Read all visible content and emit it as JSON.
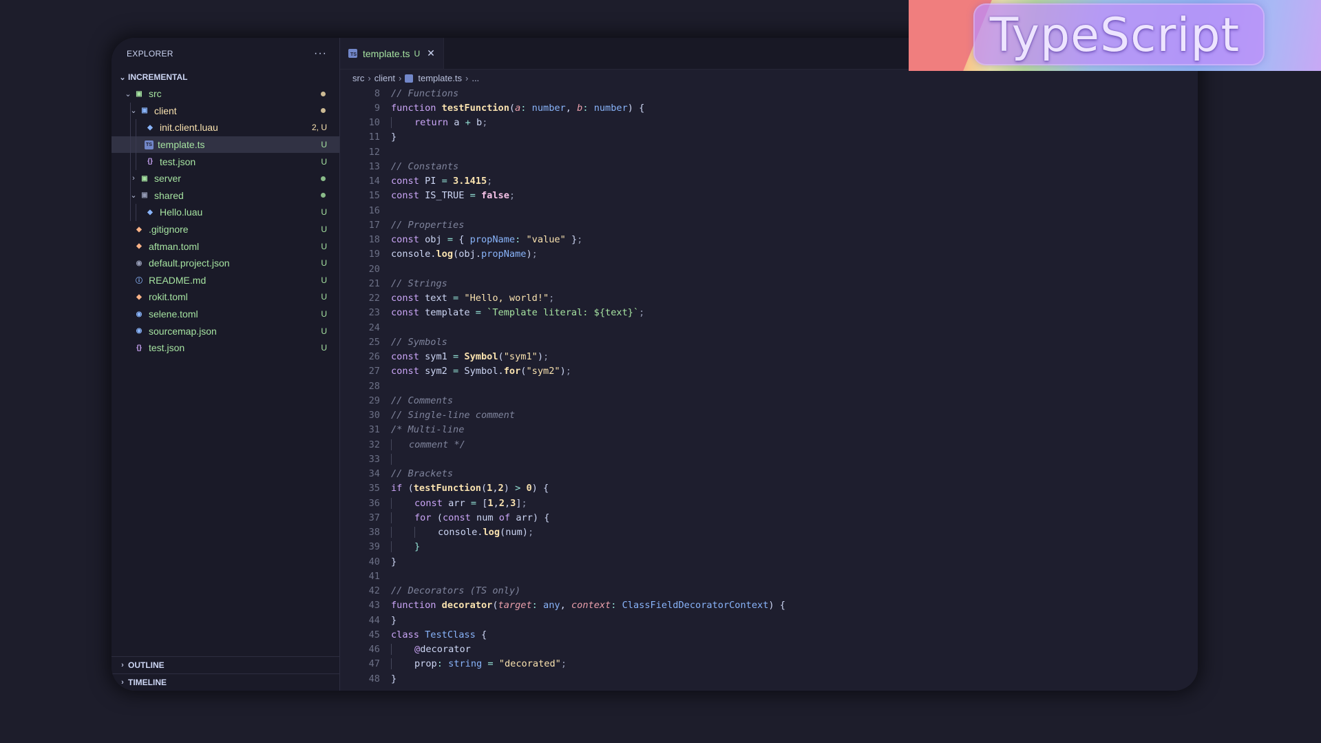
{
  "banner": {
    "text": "TypeScript"
  },
  "explorer": {
    "title": "EXPLORER",
    "more_label": "···",
    "project": "INCREMENTAL",
    "items": [
      {
        "label": "src",
        "depth": 0,
        "folder": true,
        "chev": "open",
        "color": "#a6e3a1",
        "icon": "src-folder-icon",
        "iconColor": "#a6e3a1",
        "dot": "#f9e2af"
      },
      {
        "label": "client",
        "depth": 1,
        "folder": true,
        "chev": "open",
        "color": "#f9e2af",
        "icon": "client-folder-icon",
        "iconColor": "#89b4fa",
        "dot": "#f9e2af"
      },
      {
        "label": "init.client.luau",
        "depth": 2,
        "folder": false,
        "color": "#f9e2af",
        "icon": "luau-file-icon",
        "iconColor": "#89b4fa",
        "badge": "2, U",
        "badgeColor": "#f9e2af"
      },
      {
        "label": "template.ts",
        "depth": 2,
        "folder": false,
        "color": "#a6e3a1",
        "icon": "typescript-file-icon",
        "iconColor": "#7287c9",
        "badge": "U",
        "badgeColor": "#a6e3a1",
        "selected": true
      },
      {
        "label": "test.json",
        "depth": 2,
        "folder": false,
        "color": "#a6e3a1",
        "icon": "json-file-icon",
        "iconColor": "#cba6f7",
        "badge": "U",
        "badgeColor": "#a6e3a1"
      },
      {
        "label": "server",
        "depth": 1,
        "folder": true,
        "chev": "closed",
        "color": "#a6e3a1",
        "icon": "server-folder-icon",
        "iconColor": "#a6e3a1",
        "dot": "#a6e3a1"
      },
      {
        "label": "shared",
        "depth": 1,
        "folder": true,
        "chev": "open",
        "color": "#a6e3a1",
        "icon": "shared-folder-icon",
        "iconColor": "#9399b2",
        "dot": "#a6e3a1"
      },
      {
        "label": "Hello.luau",
        "depth": 2,
        "folder": false,
        "color": "#a6e3a1",
        "icon": "luau-file-icon",
        "iconColor": "#89b4fa",
        "badge": "U",
        "badgeColor": "#a6e3a1"
      },
      {
        "label": ".gitignore",
        "depth": 0,
        "folder": false,
        "color": "#a6e3a1",
        "icon": "git-file-icon",
        "iconColor": "#fab387",
        "badge": "U",
        "badgeColor": "#a6e3a1"
      },
      {
        "label": "aftman.toml",
        "depth": 0,
        "folder": false,
        "color": "#a6e3a1",
        "icon": "toml-file-icon",
        "iconColor": "#fab387",
        "badge": "U",
        "badgeColor": "#a6e3a1"
      },
      {
        "label": "default.project.json",
        "depth": 0,
        "folder": false,
        "color": "#a6e3a1",
        "icon": "project-file-icon",
        "iconColor": "#9399b2",
        "badge": "U",
        "badgeColor": "#a6e3a1"
      },
      {
        "label": "README.md",
        "depth": 0,
        "folder": false,
        "color": "#a6e3a1",
        "icon": "info-file-icon",
        "iconColor": "#89b4fa",
        "badge": "U",
        "badgeColor": "#a6e3a1"
      },
      {
        "label": "rokit.toml",
        "depth": 0,
        "folder": false,
        "color": "#a6e3a1",
        "icon": "toml-file-icon",
        "iconColor": "#fab387",
        "badge": "U",
        "badgeColor": "#a6e3a1"
      },
      {
        "label": "selene.toml",
        "depth": 0,
        "folder": false,
        "color": "#a6e3a1",
        "icon": "selene-file-icon",
        "iconColor": "#89b4fa",
        "badge": "U",
        "badgeColor": "#a6e3a1"
      },
      {
        "label": "sourcemap.json",
        "depth": 0,
        "folder": false,
        "color": "#a6e3a1",
        "icon": "sourcemap-file-icon",
        "iconColor": "#89b4fa",
        "badge": "U",
        "badgeColor": "#a6e3a1"
      },
      {
        "label": "test.json",
        "depth": 0,
        "folder": false,
        "color": "#a6e3a1",
        "icon": "json-file-icon",
        "iconColor": "#cba6f7",
        "badge": "U",
        "badgeColor": "#a6e3a1"
      }
    ],
    "outline": "OUTLINE",
    "timeline": "TIMELINE"
  },
  "editor": {
    "tab": {
      "label": "template.ts",
      "status": "U",
      "close": "✕"
    },
    "breadcrumb": [
      "src",
      "client",
      "template.ts",
      "..."
    ],
    "lines": [
      {
        "n": 8,
        "i": 0,
        "t": [
          [
            "cm",
            "// Functions"
          ]
        ]
      },
      {
        "n": 9,
        "i": 0,
        "t": [
          [
            "kw",
            "function "
          ],
          [
            "fn",
            "testFunction"
          ],
          [
            "",
            "("
          ],
          [
            "pm",
            "a"
          ],
          [
            "op",
            ": "
          ],
          [
            "ty",
            "number"
          ],
          [
            "",
            ", "
          ],
          [
            "pm",
            "b"
          ],
          [
            "op",
            ": "
          ],
          [
            "ty",
            "number"
          ],
          [
            "",
            ") {"
          ]
        ]
      },
      {
        "n": 10,
        "i": 1,
        "t": [
          [
            "kw",
            "return "
          ],
          [
            "",
            "a "
          ],
          [
            "op",
            "+"
          ],
          [
            "",
            " b"
          ],
          [
            "pu",
            ";"
          ]
        ]
      },
      {
        "n": 11,
        "i": 0,
        "t": [
          [
            "",
            "}"
          ]
        ]
      },
      {
        "n": 12,
        "i": 0,
        "t": []
      },
      {
        "n": 13,
        "i": 0,
        "t": [
          [
            "cm",
            "// Constants"
          ]
        ]
      },
      {
        "n": 14,
        "i": 0,
        "t": [
          [
            "kw",
            "const "
          ],
          [
            "",
            "PI "
          ],
          [
            "op",
            "= "
          ],
          [
            "nm",
            "3.1415"
          ],
          [
            "pu",
            ";"
          ]
        ]
      },
      {
        "n": 15,
        "i": 0,
        "t": [
          [
            "kw",
            "const "
          ],
          [
            "",
            "IS_TRUE "
          ],
          [
            "op",
            "= "
          ],
          [
            "bl",
            "false"
          ],
          [
            "pu",
            ";"
          ]
        ]
      },
      {
        "n": 16,
        "i": 0,
        "t": []
      },
      {
        "n": 17,
        "i": 0,
        "t": [
          [
            "cm",
            "// Properties"
          ]
        ]
      },
      {
        "n": 18,
        "i": 0,
        "t": [
          [
            "kw",
            "const "
          ],
          [
            "",
            "obj "
          ],
          [
            "op",
            "= "
          ],
          [
            "",
            "{ "
          ],
          [
            "pr",
            "propName"
          ],
          [
            "op",
            ": "
          ],
          [
            "st",
            "\"value\""
          ],
          [
            "",
            " }"
          ],
          [
            "pu",
            ";"
          ]
        ]
      },
      {
        "n": 19,
        "i": 0,
        "t": [
          [
            "",
            "console."
          ],
          [
            "fn",
            "log"
          ],
          [
            "",
            "(obj."
          ],
          [
            "pr",
            "propName"
          ],
          [
            "",
            ")"
          ],
          [
            "pu",
            ";"
          ]
        ]
      },
      {
        "n": 20,
        "i": 0,
        "t": []
      },
      {
        "n": 21,
        "i": 0,
        "t": [
          [
            "cm",
            "// Strings"
          ]
        ]
      },
      {
        "n": 22,
        "i": 0,
        "t": [
          [
            "kw",
            "const "
          ],
          [
            "",
            "text "
          ],
          [
            "op",
            "= "
          ],
          [
            "st",
            "\"Hello, world!\""
          ],
          [
            "pu",
            ";"
          ]
        ]
      },
      {
        "n": 23,
        "i": 0,
        "t": [
          [
            "kw",
            "const "
          ],
          [
            "",
            "template "
          ],
          [
            "op",
            "= "
          ],
          [
            "sx",
            "`Template literal: ${text}`"
          ],
          [
            "pu",
            ";"
          ]
        ]
      },
      {
        "n": 24,
        "i": 0,
        "t": []
      },
      {
        "n": 25,
        "i": 0,
        "t": [
          [
            "cm",
            "// Symbols"
          ]
        ]
      },
      {
        "n": 26,
        "i": 0,
        "t": [
          [
            "kw",
            "const "
          ],
          [
            "",
            "sym1 "
          ],
          [
            "op",
            "= "
          ],
          [
            "fn",
            "Symbol"
          ],
          [
            "",
            "("
          ],
          [
            "st",
            "\"sym1\""
          ],
          [
            "",
            ")"
          ],
          [
            "pu",
            ";"
          ]
        ]
      },
      {
        "n": 27,
        "i": 0,
        "t": [
          [
            "kw",
            "const "
          ],
          [
            "",
            "sym2 "
          ],
          [
            "op",
            "= "
          ],
          [
            "",
            "Symbol."
          ],
          [
            "fn",
            "for"
          ],
          [
            "",
            "("
          ],
          [
            "st",
            "\"sym2\""
          ],
          [
            "",
            ")"
          ],
          [
            "pu",
            ";"
          ]
        ]
      },
      {
        "n": 28,
        "i": 0,
        "t": []
      },
      {
        "n": 29,
        "i": 0,
        "t": [
          [
            "cm",
            "// Comments"
          ]
        ]
      },
      {
        "n": 30,
        "i": 0,
        "t": [
          [
            "cm",
            "// Single-line comment"
          ]
        ]
      },
      {
        "n": 31,
        "i": 0,
        "t": [
          [
            "cm",
            "/* Multi-line"
          ]
        ]
      },
      {
        "n": 32,
        "i": 1,
        "t": [
          [
            "cm",
            "comment */"
          ]
        ],
        "pad": "   "
      },
      {
        "n": 33,
        "i": 1,
        "t": []
      },
      {
        "n": 34,
        "i": 0,
        "t": [
          [
            "cm",
            "// Brackets"
          ]
        ]
      },
      {
        "n": 35,
        "i": 0,
        "t": [
          [
            "kw",
            "if "
          ],
          [
            "",
            "("
          ],
          [
            "fn",
            "testFunction"
          ],
          [
            "",
            "("
          ],
          [
            "nm",
            "1"
          ],
          [
            "",
            ","
          ],
          [
            "nm",
            "2"
          ],
          [
            "",
            ") "
          ],
          [
            "op",
            "> "
          ],
          [
            "nm",
            "0"
          ],
          [
            "",
            ") {"
          ]
        ]
      },
      {
        "n": 36,
        "i": 1,
        "t": [
          [
            "kw",
            "const "
          ],
          [
            "",
            "arr "
          ],
          [
            "op",
            "= "
          ],
          [
            "",
            "["
          ],
          [
            "nm",
            "1"
          ],
          [
            "",
            ","
          ],
          [
            "nm",
            "2"
          ],
          [
            "",
            ","
          ],
          [
            "nm",
            "3"
          ],
          [
            "",
            "]"
          ],
          [
            "pu",
            ";"
          ]
        ]
      },
      {
        "n": 37,
        "i": 1,
        "t": [
          [
            "kw",
            "for "
          ],
          [
            "",
            "("
          ],
          [
            "kw",
            "const "
          ],
          [
            "",
            "num "
          ],
          [
            "kw",
            "of "
          ],
          [
            "",
            "arr) {"
          ]
        ]
      },
      {
        "n": 38,
        "i": 2,
        "t": [
          [
            "",
            "console."
          ],
          [
            "fn",
            "log"
          ],
          [
            "",
            "(num)"
          ],
          [
            "pu",
            ";"
          ]
        ]
      },
      {
        "n": 39,
        "i": 1,
        "t": [
          [
            "op",
            "}"
          ]
        ]
      },
      {
        "n": 40,
        "i": 0,
        "t": [
          [
            "",
            "}"
          ]
        ]
      },
      {
        "n": 41,
        "i": 0,
        "t": []
      },
      {
        "n": 42,
        "i": 0,
        "t": [
          [
            "cm",
            "// Decorators (TS only)"
          ]
        ]
      },
      {
        "n": 43,
        "i": 0,
        "t": [
          [
            "kw",
            "function "
          ],
          [
            "fn",
            "decorator"
          ],
          [
            "",
            "("
          ],
          [
            "pm",
            "target"
          ],
          [
            "op",
            ": "
          ],
          [
            "ty",
            "any"
          ],
          [
            "",
            ", "
          ],
          [
            "pm",
            "context"
          ],
          [
            "op",
            ": "
          ],
          [
            "cls",
            "ClassFieldDecoratorContext"
          ],
          [
            "",
            ") {"
          ]
        ]
      },
      {
        "n": 44,
        "i": 0,
        "t": [
          [
            "",
            "}"
          ]
        ]
      },
      {
        "n": 45,
        "i": 0,
        "t": [
          [
            "kw",
            "class "
          ],
          [
            "cls",
            "TestClass"
          ],
          [
            "",
            " {"
          ]
        ]
      },
      {
        "n": 46,
        "i": 1,
        "t": [
          [
            "dec",
            "@"
          ],
          [
            "",
            "decorator"
          ]
        ]
      },
      {
        "n": 47,
        "i": 1,
        "t": [
          [
            "",
            "prop"
          ],
          [
            "op",
            ": "
          ],
          [
            "ty",
            "string "
          ],
          [
            "op",
            "= "
          ],
          [
            "st",
            "\"decorated\""
          ],
          [
            "pu",
            ";"
          ]
        ]
      },
      {
        "n": 48,
        "i": 0,
        "t": [
          [
            "",
            "}"
          ]
        ]
      }
    ]
  }
}
